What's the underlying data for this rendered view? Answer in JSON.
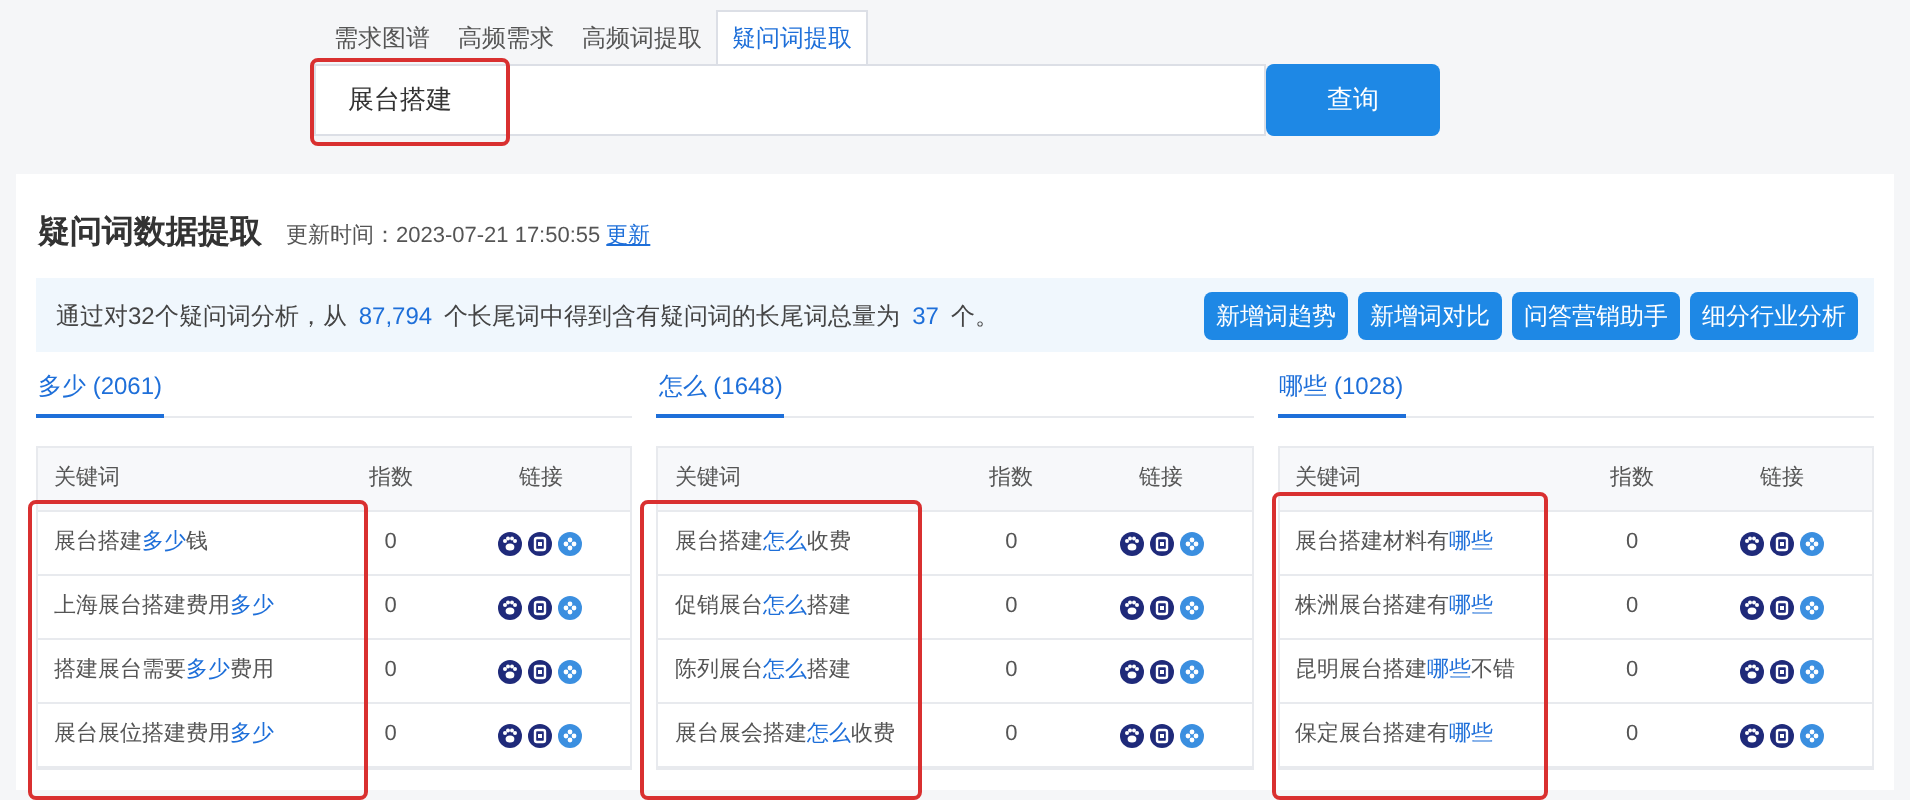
{
  "tabs": [
    {
      "label": "需求图谱",
      "selected": false
    },
    {
      "label": "高频需求",
      "selected": false
    },
    {
      "label": "高频词提取",
      "selected": false
    },
    {
      "label": "疑问词提取",
      "selected": true
    }
  ],
  "search": {
    "value": "展台搭建",
    "button": "查询"
  },
  "panel": {
    "title": "疑问词数据提取",
    "updated_label": "更新时间：2023-07-21 17:50:55",
    "update_link": "更新",
    "summary": [
      {
        "text": "通过对32个疑问词分析，从",
        "highlight": false
      },
      {
        "text": "87,794",
        "highlight": true
      },
      {
        "text": "个长尾词中得到含有疑问词的长尾词总量为",
        "highlight": false
      },
      {
        "text": "37",
        "highlight": true
      },
      {
        "text": "个。",
        "highlight": false
      }
    ],
    "actions": [
      "新增词趋势",
      "新增词对比",
      "问答营销助手",
      "细分行业分析"
    ],
    "groups": [
      {
        "title": "多少 (2061)",
        "columns": [
          "关键词",
          "指数",
          "链接"
        ],
        "rows": [
          {
            "keyword": [
              {
                "text": "展台搭建",
                "highlight": false
              },
              {
                "text": "多少",
                "highlight": true
              },
              {
                "text": "钱",
                "highlight": false
              }
            ],
            "index": "0"
          },
          {
            "keyword": [
              {
                "text": "上海展台搭建费用",
                "highlight": false
              },
              {
                "text": "多少",
                "highlight": true
              }
            ],
            "index": "0"
          },
          {
            "keyword": [
              {
                "text": "搭建展台需要",
                "highlight": false
              },
              {
                "text": "多少",
                "highlight": true
              },
              {
                "text": "费用",
                "highlight": false
              }
            ],
            "index": "0"
          },
          {
            "keyword": [
              {
                "text": "展台展位搭建费用",
                "highlight": false
              },
              {
                "text": "多少",
                "highlight": true
              }
            ],
            "index": "0"
          }
        ]
      },
      {
        "title": "怎么 (1648)",
        "columns": [
          "关键词",
          "指数",
          "链接"
        ],
        "rows": [
          {
            "keyword": [
              {
                "text": "展台搭建",
                "highlight": false
              },
              {
                "text": "怎么",
                "highlight": true
              },
              {
                "text": "收费",
                "highlight": false
              }
            ],
            "index": "0"
          },
          {
            "keyword": [
              {
                "text": "促销展台",
                "highlight": false
              },
              {
                "text": "怎么",
                "highlight": true
              },
              {
                "text": "搭建",
                "highlight": false
              }
            ],
            "index": "0"
          },
          {
            "keyword": [
              {
                "text": "陈列展台",
                "highlight": false
              },
              {
                "text": "怎么",
                "highlight": true
              },
              {
                "text": "搭建",
                "highlight": false
              }
            ],
            "index": "0"
          },
          {
            "keyword": [
              {
                "text": "展台展会搭建",
                "highlight": false
              },
              {
                "text": "怎么",
                "highlight": true
              },
              {
                "text": "收费",
                "highlight": false
              }
            ],
            "index": "0"
          }
        ]
      },
      {
        "title": "哪些 (1028)",
        "columns": [
          "关键词",
          "指数",
          "链接"
        ],
        "rows": [
          {
            "keyword": [
              {
                "text": "展台搭建材料有",
                "highlight": false
              },
              {
                "text": "哪些",
                "highlight": true
              }
            ],
            "index": "0"
          },
          {
            "keyword": [
              {
                "text": "株洲展台搭建有",
                "highlight": false
              },
              {
                "text": "哪些",
                "highlight": true
              }
            ],
            "index": "0"
          },
          {
            "keyword": [
              {
                "text": "昆明展台搭建",
                "highlight": false
              },
              {
                "text": "哪些",
                "highlight": true
              },
              {
                "text": "不错",
                "highlight": false
              }
            ],
            "index": "0"
          },
          {
            "keyword": [
              {
                "text": "保定展台搭建有",
                "highlight": false
              },
              {
                "text": "哪些",
                "highlight": true
              }
            ],
            "index": "0"
          }
        ]
      }
    ]
  }
}
